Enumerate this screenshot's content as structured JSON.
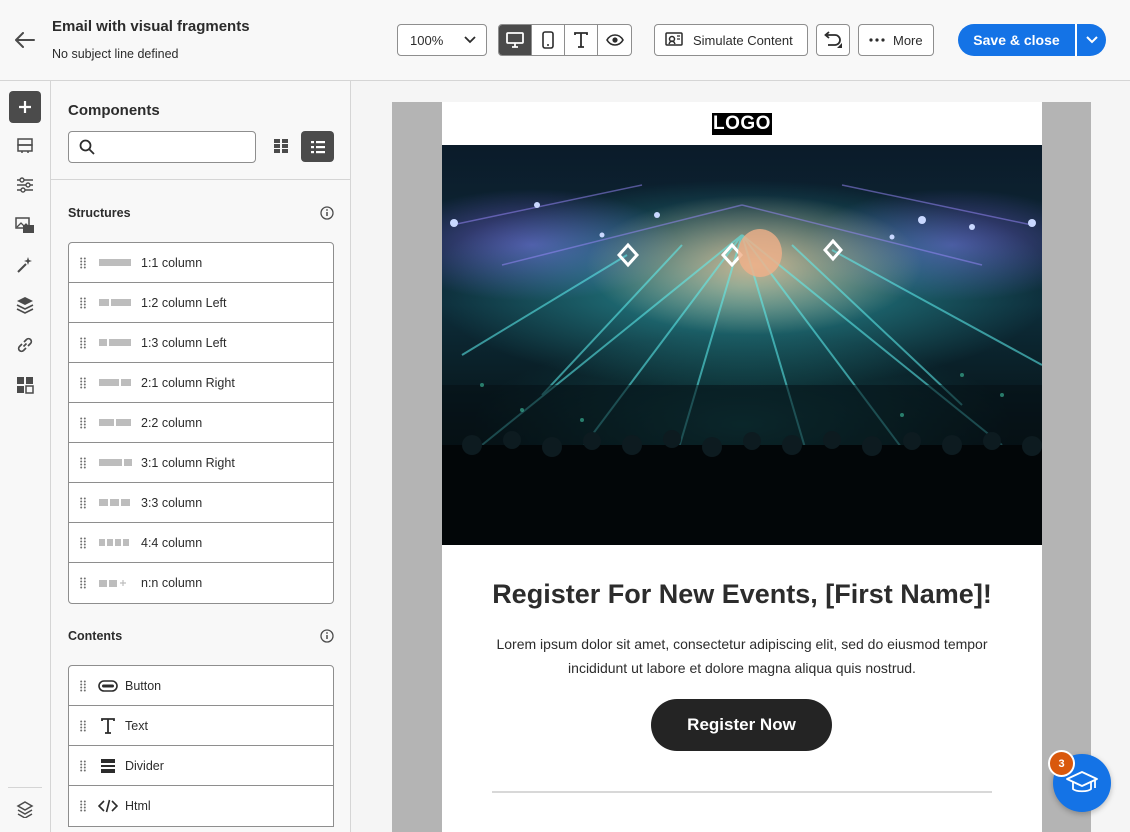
{
  "header": {
    "title": "Email with visual fragments",
    "subtitle": "No subject line defined",
    "zoom": "100%",
    "simulate_label": "Simulate Content",
    "more_label": "More",
    "save_label": "Save & close",
    "active_view": "desktop"
  },
  "panel": {
    "title": "Components",
    "search_placeholder": "",
    "view_mode": "list",
    "structures_title": "Structures",
    "structures": [
      {
        "label": "1:1 column"
      },
      {
        "label": "1:2 column Left"
      },
      {
        "label": "1:3 column Left"
      },
      {
        "label": "2:1 column Right"
      },
      {
        "label": "2:2 column"
      },
      {
        "label": "3:1 column Right"
      },
      {
        "label": "3:3 column"
      },
      {
        "label": "4:4 column"
      },
      {
        "label": "n:n column"
      }
    ],
    "contents_title": "Contents",
    "contents": [
      {
        "label": "Button",
        "icon": "button-icon"
      },
      {
        "label": "Text",
        "icon": "text-icon"
      },
      {
        "label": "Divider",
        "icon": "divider-icon"
      },
      {
        "label": "Html",
        "icon": "code-icon"
      }
    ]
  },
  "email": {
    "logo_text": "LOGO",
    "headline": "Register For New Events, [First Name]!",
    "body_line1": "Lorem ipsum dolor sit amet, consectetur adipiscing elit, sed do eiusmod tempor",
    "body_line2": "incididunt ut labore et dolore magna aliqua quis nostrud.",
    "cta_label": "Register Now",
    "hero_image": "concert-crowd-image"
  },
  "help": {
    "badge_count": "3",
    "icon": "graduation-cap-icon"
  },
  "colors": {
    "accent": "#1473e6",
    "badge": "#d9580c",
    "active_dark": "#4b4b4b",
    "cta_bg": "#242424"
  }
}
